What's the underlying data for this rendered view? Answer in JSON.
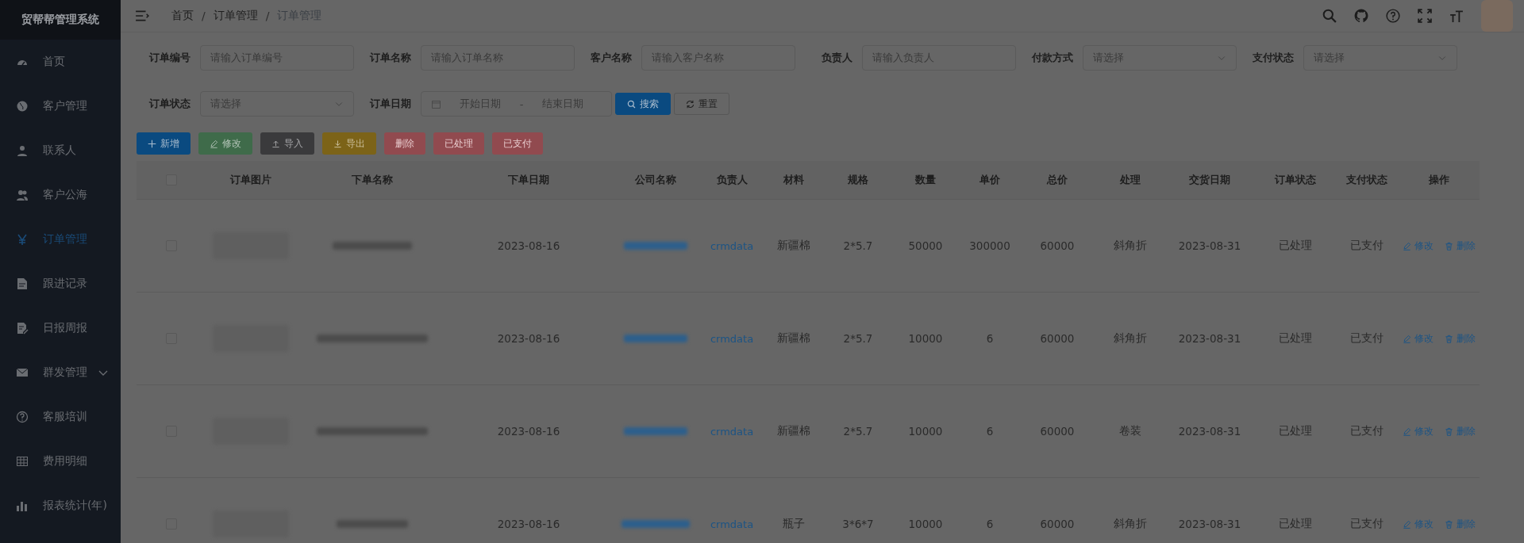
{
  "sidebar": {
    "title": "贸帮帮管理系统",
    "items": [
      {
        "label": "首页",
        "selected": false,
        "has_children": false
      },
      {
        "label": "客户管理",
        "selected": false,
        "has_children": false
      },
      {
        "label": "联系人",
        "selected": false,
        "has_children": false
      },
      {
        "label": "客户公海",
        "selected": false,
        "has_children": false
      },
      {
        "label": "订单管理",
        "selected": true,
        "has_children": false
      },
      {
        "label": "跟进记录",
        "selected": false,
        "has_children": false
      },
      {
        "label": "日报周报",
        "selected": false,
        "has_children": false
      },
      {
        "label": "群发管理",
        "selected": false,
        "has_children": true
      },
      {
        "label": "客服培训",
        "selected": false,
        "has_children": false
      },
      {
        "label": "费用明细",
        "selected": false,
        "has_children": false
      },
      {
        "label": "报表统计(年)",
        "selected": false,
        "has_children": false
      }
    ]
  },
  "breadcrumb": [
    {
      "label": "首页",
      "current": false
    },
    {
      "separator": "/",
      "label": "订单管理",
      "current": false
    },
    {
      "separator": "/",
      "label": "订单管理",
      "current": true
    }
  ],
  "filters": [
    {
      "kind": "text",
      "label": "订单编号",
      "placeholder": "请输入订单编号"
    },
    {
      "kind": "text",
      "label": "订单名称",
      "placeholder": "请输入订单名称"
    },
    {
      "kind": "text",
      "label": "客户名称",
      "placeholder": "请输入客户名称"
    },
    {
      "kind": "text",
      "label": "负责人",
      "placeholder": "请输入负责人"
    },
    {
      "kind": "select",
      "label": "付款方式",
      "placeholder": "请选择"
    },
    {
      "kind": "select",
      "label": "支付状态",
      "placeholder": "请选择"
    },
    {
      "kind": "select",
      "label": "订单状态",
      "placeholder": "请选择"
    },
    {
      "kind": "daterange",
      "label": "订单日期",
      "start_placeholder": "开始日期",
      "separator": "-",
      "end_placeholder": "结束日期"
    }
  ],
  "search_button": "搜索",
  "reset_button": "重置",
  "toolbar": [
    {
      "label": "新增",
      "kind": "primary",
      "disabled": false
    },
    {
      "label": "修改",
      "kind": "success",
      "disabled": false
    },
    {
      "label": "导入",
      "kind": "info",
      "disabled": false
    },
    {
      "label": "导出",
      "kind": "warning",
      "disabled": false
    },
    {
      "label": "删除",
      "kind": "danger",
      "disabled": true
    },
    {
      "label": "已处理",
      "kind": "danger",
      "disabled": true
    },
    {
      "label": "已支付",
      "kind": "danger",
      "disabled": true
    }
  ],
  "table": {
    "all_selected": false,
    "columns": [
      "订单图片",
      "下单名称",
      "下单日期",
      "公司名称",
      "负责人",
      "材料",
      "规格",
      "数量",
      "单价",
      "总价",
      "处理",
      "交货日期",
      "订单状态",
      "支付状态",
      "操作"
    ],
    "rows": [
      {
        "selected": false,
        "order_date": "2023-08-16",
        "owner": "crmdata",
        "material": "新疆棉",
        "spec": "2*5.7",
        "quantity": "50000",
        "unit_price": "300000",
        "total": "60000",
        "process": "斜角折",
        "delivery_date": "2023-08-31",
        "order_status": "已处理",
        "pay_status": "已支付",
        "actions": [
          "修改",
          "删除"
        ]
      },
      {
        "selected": false,
        "order_date": "2023-08-16",
        "owner": "crmdata",
        "material": "新疆棉",
        "spec": "2*5.7",
        "quantity": "10000",
        "unit_price": "6",
        "total": "60000",
        "process": "斜角折",
        "delivery_date": "2023-08-31",
        "order_status": "已处理",
        "pay_status": "已支付",
        "actions": [
          "修改",
          "删除"
        ]
      },
      {
        "selected": false,
        "order_date": "2023-08-16",
        "owner": "crmdata",
        "material": "新疆棉",
        "spec": "2*5.7",
        "quantity": "10000",
        "unit_price": "6",
        "total": "60000",
        "process": "卷装",
        "delivery_date": "2023-08-31",
        "order_status": "已处理",
        "pay_status": "已支付",
        "actions": [
          "修改",
          "删除"
        ]
      },
      {
        "selected": false,
        "order_date": "2023-08-16",
        "owner": "crmdata",
        "material": "瓶子",
        "spec": "3*6*7",
        "quantity": "10000",
        "unit_price": "6",
        "total": "60000",
        "process": "斜角折",
        "delivery_date": "2023-08-31",
        "order_status": "已处理",
        "pay_status": "已支付",
        "actions": [
          "修改",
          "删除"
        ]
      }
    ]
  }
}
